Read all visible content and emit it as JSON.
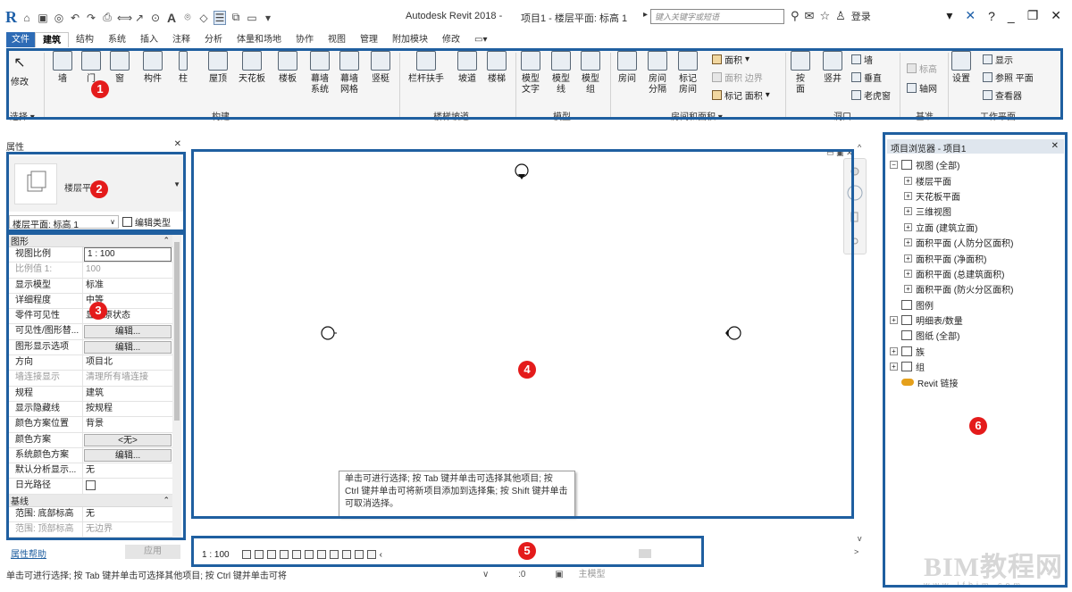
{
  "window": {
    "app_title": "Autodesk Revit 2018 -",
    "doc_title": "项目1 - 楼层平面: 标高 1",
    "search_placeholder": "键入关键字或短语",
    "login_label": "登录"
  },
  "ribbon": {
    "tabs": [
      "文件",
      "建筑",
      "结构",
      "系统",
      "插入",
      "注释",
      "分析",
      "体量和场地",
      "协作",
      "视图",
      "管理",
      "附加模块",
      "修改"
    ],
    "active_tab": "建筑",
    "buttons": {
      "modify": "修改",
      "wall": "墙",
      "door": "门",
      "window": "窗",
      "component": "构件",
      "column": "柱",
      "roof": "屋顶",
      "ceiling": "天花板",
      "floor": "楼板",
      "curtain_system": "幕墙\n系统",
      "curtain_grid": "幕墙\n网格",
      "mullion": "竖梃",
      "railing": "栏杆扶手",
      "ramp": "坡道",
      "stair": "楼梯",
      "model_text": "模型\n文字",
      "model_line": "模型\n线",
      "model_group": "模型\n组",
      "room": "房间",
      "room_separator": "房间\n分隔",
      "tag_room": "标记\n房间",
      "by_face": "按\n面",
      "shaft": "竖井",
      "set": "设置",
      "grid_axis": "轴网"
    },
    "small_buttons": {
      "area": "面积",
      "area_boundary": "面积 边界",
      "tag_area": "标记 面积",
      "opening_wall": "墙",
      "opening_vertical": "垂直",
      "dormer": "老虎窗",
      "level": "标高",
      "show": "显示",
      "ref_plane": "参照 平面",
      "viewer": "查看器"
    },
    "panels": {
      "select": "选择",
      "build": "构建",
      "circulation": "楼梯坡道",
      "model": "模型",
      "room_area": "房间和面积",
      "opening": "洞口",
      "datum": "基准",
      "work_plane": "工作平面"
    }
  },
  "properties": {
    "title": "属性",
    "type_name": "楼层平面",
    "type_selector": "楼层平面: 标高 1",
    "edit_type": "编辑类型",
    "groups": [
      {
        "name": "图形",
        "rows": [
          {
            "name": "视图比例",
            "value": "1 : 100",
            "kind": "input"
          },
          {
            "name": "比例值 1:",
            "value": "100",
            "kind": "dim"
          },
          {
            "name": "显示模型",
            "value": "标准",
            "kind": "text"
          },
          {
            "name": "详细程度",
            "value": "中等",
            "kind": "text"
          },
          {
            "name": "零件可见性",
            "value": "显示原状态",
            "kind": "text"
          },
          {
            "name": "可见性/图形替...",
            "value": "编辑...",
            "kind": "button"
          },
          {
            "name": "图形显示选项",
            "value": "编辑...",
            "kind": "button"
          },
          {
            "name": "方向",
            "value": "项目北",
            "kind": "text"
          },
          {
            "name": "墙连接显示",
            "value": "清理所有墙连接",
            "kind": "dim"
          },
          {
            "name": "规程",
            "value": "建筑",
            "kind": "text"
          },
          {
            "name": "显示隐藏线",
            "value": "按规程",
            "kind": "text"
          },
          {
            "name": "颜色方案位置",
            "value": "背景",
            "kind": "text"
          },
          {
            "name": "颜色方案",
            "value": "<无>",
            "kind": "button"
          },
          {
            "name": "系统颜色方案",
            "value": "编辑...",
            "kind": "button"
          },
          {
            "name": "默认分析显示...",
            "value": "无",
            "kind": "text"
          },
          {
            "name": "日光路径",
            "value": "",
            "kind": "checkbox"
          }
        ]
      },
      {
        "name": "基线",
        "rows": [
          {
            "name": "范围: 底部标高",
            "value": "无",
            "kind": "text"
          },
          {
            "name": "范围: 顶部标高",
            "value": "无边界",
            "kind": "dim"
          }
        ]
      }
    ],
    "help_link": "属性帮助",
    "apply": "应用"
  },
  "canvas": {
    "tooltip": "单击可进行选择; 按 Tab 键并单击可选择其他项目; 按 Ctrl 键并单击可将新项目添加到选择集; 按 Shift 键并单击可取消选择。"
  },
  "view_control": {
    "scale": "1 : 100"
  },
  "project_browser": {
    "title": "项目浏览器 - 项目1",
    "items": [
      {
        "label": "视图 (全部)",
        "level": 0,
        "toggle": "−",
        "icon": "views-icon"
      },
      {
        "label": "楼层平面",
        "level": 1,
        "toggle": "+",
        "icon": ""
      },
      {
        "label": "天花板平面",
        "level": 1,
        "toggle": "+",
        "icon": ""
      },
      {
        "label": "三维视图",
        "level": 1,
        "toggle": "+",
        "icon": ""
      },
      {
        "label": "立面 (建筑立面)",
        "level": 1,
        "toggle": "+",
        "icon": ""
      },
      {
        "label": "面积平面 (人防分区面积)",
        "level": 1,
        "toggle": "+",
        "icon": ""
      },
      {
        "label": "面积平面 (净面积)",
        "level": 1,
        "toggle": "+",
        "icon": ""
      },
      {
        "label": "面积平面 (总建筑面积)",
        "level": 1,
        "toggle": "+",
        "icon": ""
      },
      {
        "label": "面积平面 (防火分区面积)",
        "level": 1,
        "toggle": "+",
        "icon": ""
      },
      {
        "label": "图例",
        "level": 0,
        "toggle": "",
        "icon": "legend-icon"
      },
      {
        "label": "明细表/数量",
        "level": 0,
        "toggle": "+",
        "icon": "schedule-icon"
      },
      {
        "label": "图纸 (全部)",
        "level": 0,
        "toggle": "",
        "icon": "sheet-icon"
      },
      {
        "label": "族",
        "level": 0,
        "toggle": "+",
        "icon": "family-icon"
      },
      {
        "label": "组",
        "level": 0,
        "toggle": "+",
        "icon": "group-icon"
      },
      {
        "label": "Revit 链接",
        "level": 0,
        "toggle": "",
        "icon": "link-icon"
      }
    ]
  },
  "status_bar": {
    "text": "单击可进行选择; 按 Tab 键并单击可选择其他项目; 按 Ctrl 键并单击可将",
    "coord": ":0",
    "model": "主模型"
  },
  "callouts": [
    "1",
    "2",
    "3",
    "4",
    "5",
    "6"
  ],
  "watermark": {
    "text": "BIM教程网",
    "url": "www.lfbim.com"
  },
  "colors": {
    "callout_frame": "#1f5fa0",
    "callout_badge": "#e41b1b",
    "file_tab": "#2d6bb5"
  }
}
